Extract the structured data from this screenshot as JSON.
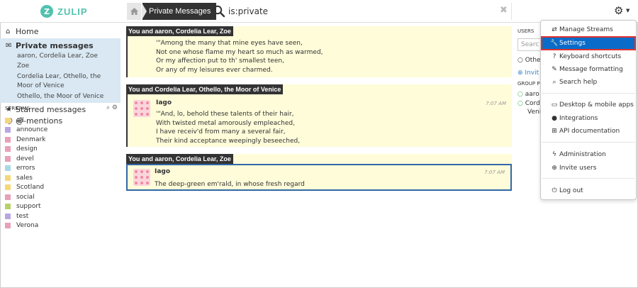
{
  "header": {
    "logo_letter": "Z",
    "logo_text": "ZULIP",
    "breadcrumb": "Private Messages",
    "search_text": "is:private"
  },
  "left_nav": {
    "home": "Home",
    "private_messages": "Private messages",
    "pm_threads": [
      "aaron, Cordelia Lear, Zoe",
      "Zoe",
      "Cordelia Lear, Othello, the",
      "Moor of Venice",
      "Othello, the Moor of Venice"
    ],
    "starred": "Starred messages",
    "mentions": "@-mentions",
    "streams_header": "STREAMS"
  },
  "streams": [
    {
      "name": "all",
      "color": "#f5d77a"
    },
    {
      "name": "announce",
      "color": "#b8a6e3"
    },
    {
      "name": "Denmark",
      "color": "#e7a1b8"
    },
    {
      "name": "design",
      "color": "#e7a1b8"
    },
    {
      "name": "devel",
      "color": "#e7a1b8"
    },
    {
      "name": "errors",
      "color": "#a7d8e6"
    },
    {
      "name": "sales",
      "color": "#f5d77a"
    },
    {
      "name": "Scotland",
      "color": "#f5d77a"
    },
    {
      "name": "social",
      "color": "#e7a1b8"
    },
    {
      "name": "support",
      "color": "#b7d26a"
    },
    {
      "name": "test",
      "color": "#b8a6e3"
    },
    {
      "name": "Verona",
      "color": "#e7a1b8"
    }
  ],
  "messages": {
    "rec1": {
      "header": "You and aaron, Cordelia Lear, Zoe",
      "lines": [
        "'\"Among the many that mine eyes have seen,",
        "Not one whose flame my heart so much as warmed,",
        "Or my affection put to th' smallest teen,",
        "Or any of my leisures ever charmed."
      ]
    },
    "rec2": {
      "header": "You and Cordelia Lear, Othello, the Moor of Venice",
      "sender": "Iago",
      "time": "7:07 AM",
      "lines": [
        "'\"And, lo, behold these talents of their hair,",
        "With twisted metal amorously empleached,",
        "I have receiv'd from many a several fair,",
        "Their kind acceptance weepingly beseeched,"
      ]
    },
    "rec3": {
      "header": "You and aaron, Cordelia Lear, Zoe",
      "sender": "Iago",
      "time": "7:07 AM",
      "lines": [
        "The deep-green em'rald, in whose fresh regard"
      ]
    }
  },
  "right_sidebar": {
    "users_header": "USERS",
    "search_placeholder": "Searc",
    "other": "Othe",
    "invite": "Invit",
    "group_header": "GROUP P",
    "users": [
      "aaro",
      "Cord",
      "Venic"
    ]
  },
  "menu": {
    "items": [
      {
        "label": "Manage Streams",
        "icon": "exchange-icon"
      },
      {
        "label": "Settings",
        "icon": "wrench-icon"
      },
      {
        "label": "Keyboard shortcuts",
        "icon": "question-circle-icon"
      },
      {
        "label": "Message formatting",
        "icon": "pencil-icon"
      },
      {
        "label": "Search help",
        "icon": "search-icon"
      },
      {
        "label": "Desktop & mobile apps",
        "icon": "desktop-icon"
      },
      {
        "label": "Integrations",
        "icon": "github-icon"
      },
      {
        "label": "API documentation",
        "icon": "sitemap-icon"
      },
      {
        "label": "Administration",
        "icon": "bolt-icon"
      },
      {
        "label": "Invite users",
        "icon": "plus-circle-icon"
      },
      {
        "label": "Log out",
        "icon": "power-icon"
      }
    ]
  },
  "colors": {
    "brand": "#52c2af",
    "message_bg": "#fefcd9",
    "menu_active": "#0a6bc8",
    "selected_border": "#3268a8"
  }
}
